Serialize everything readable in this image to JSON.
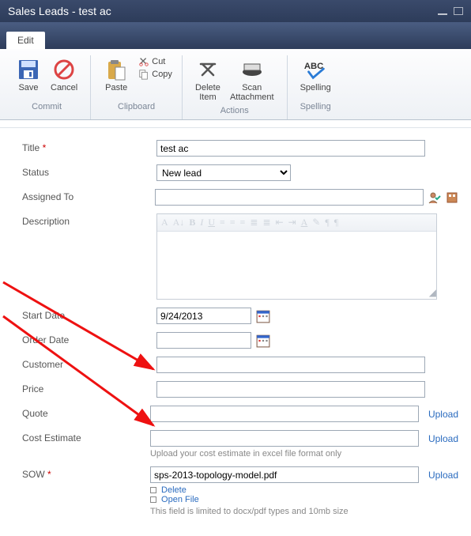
{
  "window": {
    "title": "Sales Leads - test ac"
  },
  "tabs": {
    "edit": "Edit"
  },
  "ribbon": {
    "save": "Save",
    "cancel": "Cancel",
    "paste": "Paste",
    "cut": "Cut",
    "copy": "Copy",
    "delete_item": "Delete\nItem",
    "scan_attachment": "Scan\nAttachment",
    "spelling": "Spelling",
    "group_commit": "Commit",
    "group_clipboard": "Clipboard",
    "group_actions": "Actions",
    "group_spelling": "Spelling"
  },
  "labels": {
    "title": "Title",
    "status": "Status",
    "assigned_to": "Assigned To",
    "description": "Description",
    "start_date": "Start Date",
    "order_date": "Order Date",
    "customer": "Customer",
    "price": "Price",
    "quote": "Quote",
    "cost_estimate": "Cost Estimate",
    "sow": "SOW"
  },
  "values": {
    "title": "test ac",
    "status": "New lead",
    "assigned_to": "",
    "description": "",
    "start_date": "9/24/2013",
    "order_date": "",
    "customer": "",
    "price": "",
    "quote": "",
    "cost_estimate": "",
    "sow": "sps-2013-topology-model.pdf"
  },
  "hints": {
    "cost_estimate": "Upload your cost estimate in excel file format only",
    "sow": "This field is limited to docx/pdf types and 10mb size"
  },
  "actions": {
    "upload": "Upload",
    "delete": "Delete",
    "open_file": "Open File"
  }
}
